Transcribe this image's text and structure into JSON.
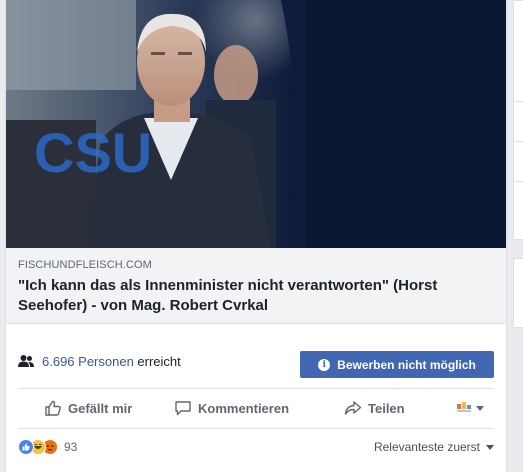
{
  "link_preview": {
    "domain": "FISCHUNDFLEISCH.COM",
    "headline": "\"Ich kann das als Innenminister nicht verantworten\" (Horst Seehofer) - von Mag. Robert Cvrkal",
    "image_text": "CSU"
  },
  "reach": {
    "count": "6.696 Personen",
    "suffix": "erreicht",
    "icon": "people-icon"
  },
  "boost_button": {
    "label": "Bewerben nicht möglich",
    "icon": "info-icon"
  },
  "actions": {
    "like": "Gefällt mir",
    "comment": "Kommentieren",
    "share": "Teilen"
  },
  "reactions": {
    "count": "93",
    "types": [
      "like",
      "haha",
      "angry"
    ]
  },
  "sort": {
    "label": "Relevanteste zuerst"
  },
  "colors": {
    "primary_blue": "#4267b2",
    "link_blue": "#385898",
    "text_gray": "#606770"
  }
}
